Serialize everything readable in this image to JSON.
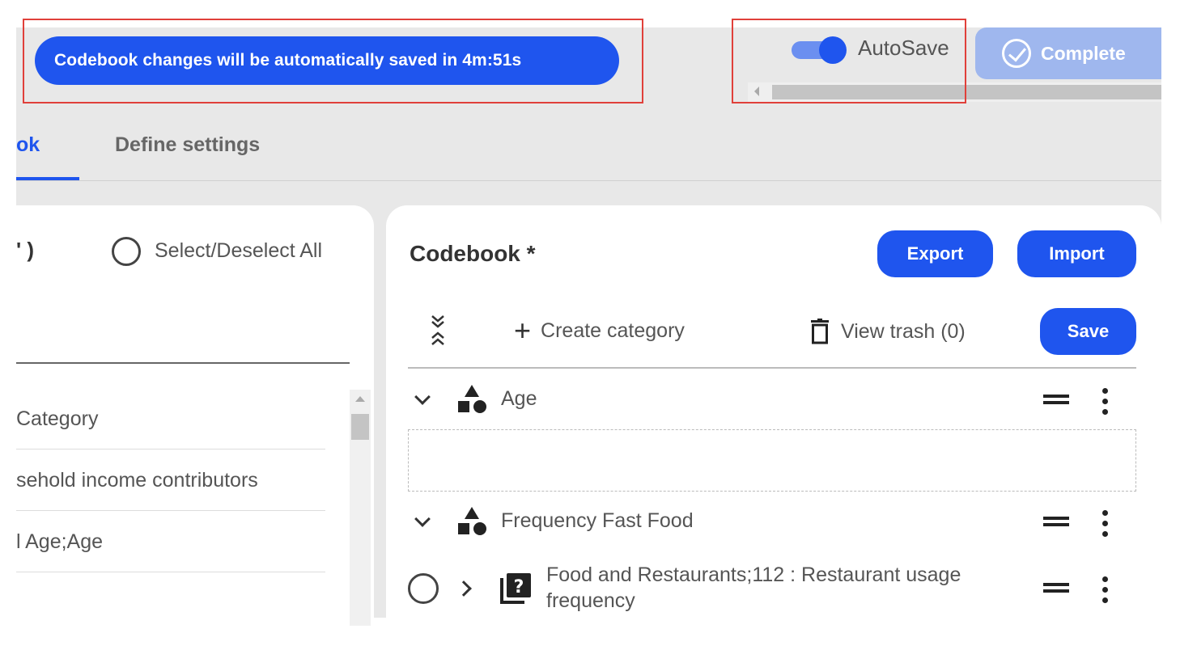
{
  "banner": {
    "text": "Codebook changes will be automatically saved in 4m:51s"
  },
  "autosave": {
    "label": "AutoSave",
    "enabled": true
  },
  "complete_button": {
    "label": "Complete"
  },
  "tabs": [
    {
      "label": "ok",
      "active": true
    },
    {
      "label": "Define settings",
      "active": false
    }
  ],
  "left_panel": {
    "count_text": "' )",
    "select_all_label": "Select/Deselect All",
    "items": [
      {
        "label": "Category"
      },
      {
        "label": "sehold income contributors"
      },
      {
        "label": "l Age;Age"
      }
    ]
  },
  "codebook": {
    "title": "Codebook *",
    "export_label": "Export",
    "import_label": "Import",
    "save_label": "Save",
    "create_category_label": "Create category",
    "view_trash_label": "View trash (0)",
    "categories": [
      {
        "label": "Age"
      },
      {
        "label": "Frequency Fast Food"
      }
    ],
    "question": {
      "label": "Food and Restaurants;112 : Restaurant usage frequency"
    }
  },
  "colors": {
    "primary": "#1f55ee",
    "complete_disabled": "#9fb7ee",
    "highlight_border": "#e0403a"
  }
}
